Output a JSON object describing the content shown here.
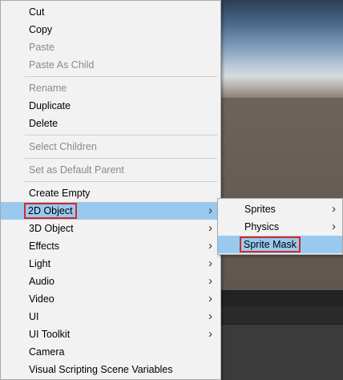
{
  "main_menu": {
    "groups": [
      [
        {
          "label": "Cut",
          "disabled": false
        },
        {
          "label": "Copy",
          "disabled": false
        },
        {
          "label": "Paste",
          "disabled": true
        },
        {
          "label": "Paste As Child",
          "disabled": true
        }
      ],
      [
        {
          "label": "Rename",
          "disabled": true
        },
        {
          "label": "Duplicate",
          "disabled": false
        },
        {
          "label": "Delete",
          "disabled": false
        }
      ],
      [
        {
          "label": "Select Children",
          "disabled": true
        }
      ],
      [
        {
          "label": "Set as Default Parent",
          "disabled": true
        }
      ],
      [
        {
          "label": "Create Empty",
          "disabled": false
        },
        {
          "label": "2D Object",
          "submenu": true,
          "highlight": true,
          "boxed": true
        },
        {
          "label": "3D Object",
          "submenu": true
        },
        {
          "label": "Effects",
          "submenu": true
        },
        {
          "label": "Light",
          "submenu": true
        },
        {
          "label": "Audio",
          "submenu": true
        },
        {
          "label": "Video",
          "submenu": true
        },
        {
          "label": "UI",
          "submenu": true
        },
        {
          "label": "UI Toolkit",
          "submenu": true
        },
        {
          "label": "Camera"
        },
        {
          "label": "Visual Scripting Scene Variables"
        }
      ]
    ]
  },
  "sub_menu": {
    "items": [
      {
        "label": "Sprites",
        "submenu": true
      },
      {
        "label": "Physics",
        "submenu": true
      },
      {
        "label": "Sprite Mask",
        "highlight": true,
        "boxed": true
      }
    ]
  },
  "icons": {
    "submenu_arrow": "chevron-right-icon"
  },
  "colors": {
    "highlight": "#99c9ef",
    "annotation_box": "#d9281f",
    "menu_bg": "#f2f2f2"
  }
}
